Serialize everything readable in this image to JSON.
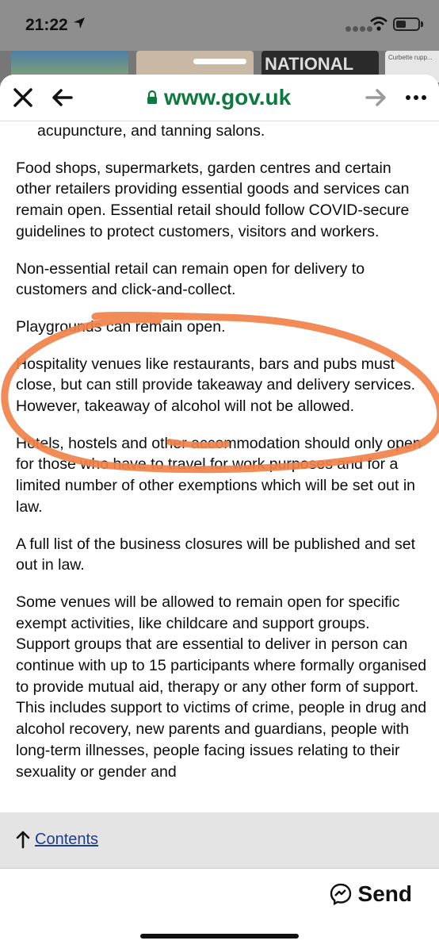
{
  "status_bar": {
    "time": "21:22"
  },
  "thumbnails": {
    "third_label": "NATIONAL",
    "fourth_label": "Curbette rupp..."
  },
  "browser": {
    "url": "www.gov.uk"
  },
  "article": {
    "fragment": "acupuncture, and tanning salons.",
    "paragraphs": [
      "Food shops, supermarkets, garden centres and certain other retailers providing essential goods and services can remain open. Essential retail should follow COVID-secure guidelines to protect customers, visitors and workers.",
      "Non-essential retail can remain open for delivery to customers and click-and-collect.",
      "Playgrounds can remain open.",
      "Hospitality venues like restaurants, bars and pubs must close, but can still provide takeaway and delivery services. However, takeaway of alcohol will not be allowed.",
      "Hotels, hostels and other accommodation should only open for those who have to travel for work purposes and for a limited number of other exemptions which will be set out in law.",
      "A full list of the business closures will be published and set out in law.",
      "Some venues will be allowed to remain open for specific exempt activities, like childcare and support groups. Support groups that are essential to deliver in person can continue with up to 15 participants where formally organised to provide mutual aid, therapy or any other form of support. This includes support to victims of crime, people in drug and alcohol recovery, new parents and guardians, people with long-term illnesses, people facing issues relating to their sexuality or gender and"
    ]
  },
  "contents_link": {
    "label": "Contents"
  },
  "share": {
    "send_label": "Send"
  },
  "colors": {
    "gov_green": "#0b7a3e",
    "annotation": "#f0824a",
    "link_blue": "#1d3d8f"
  },
  "icons": [
    "location-arrow-icon",
    "signal-icon",
    "wifi-icon",
    "battery-icon",
    "close-icon",
    "back-arrow-icon",
    "lock-icon",
    "forward-arrow-icon",
    "more-icon",
    "up-arrow-icon",
    "messenger-icon"
  ]
}
